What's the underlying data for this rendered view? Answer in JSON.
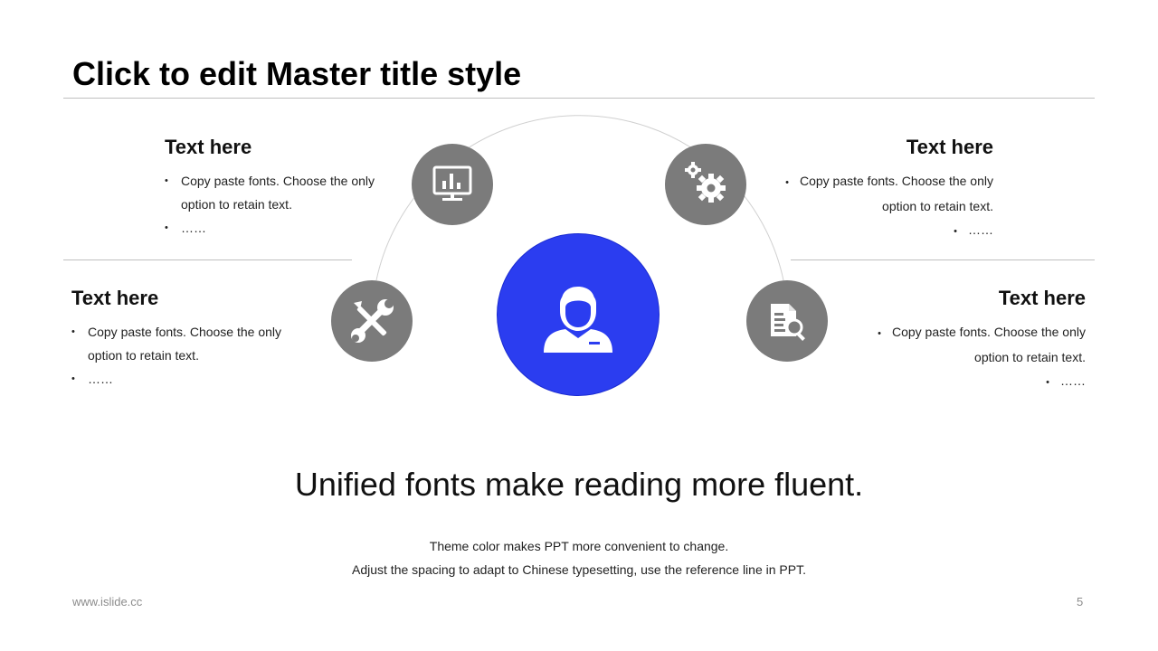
{
  "title": "Click to edit Master title style",
  "blocks": {
    "top_left": {
      "heading": "Text here",
      "bullets": [
        "Copy paste fonts. Choose the only option to retain text.",
        "……"
      ]
    },
    "top_right": {
      "heading": "Text here",
      "bullets": [
        "Copy paste fonts. Choose the only option to retain text.",
        "……"
      ]
    },
    "mid_left": {
      "heading": "Text here",
      "bullets": [
        "Copy paste fonts. Choose the only option to retain text.",
        "……"
      ]
    },
    "mid_right": {
      "heading": "Text here",
      "bullets": [
        "Copy paste fonts. Choose the only option to retain text.",
        "……"
      ]
    }
  },
  "icons": {
    "top_left": "presentation-chart-icon",
    "top_right": "gears-icon",
    "mid_left": "tools-icon",
    "mid_right": "document-search-icon",
    "center": "person-icon"
  },
  "slogan": "Unified fonts make reading more fluent.",
  "subtitle_lines": [
    "Theme color makes PPT more convenient to change.",
    "Adjust the spacing to adapt to Chinese typesetting, use the reference line in PPT."
  ],
  "footer": {
    "website": "www.islide.cc",
    "page_number": "5"
  },
  "colors": {
    "accent": "#2b3df0",
    "icon_circle": "#7b7b7b",
    "line": "#bfbfbf"
  }
}
